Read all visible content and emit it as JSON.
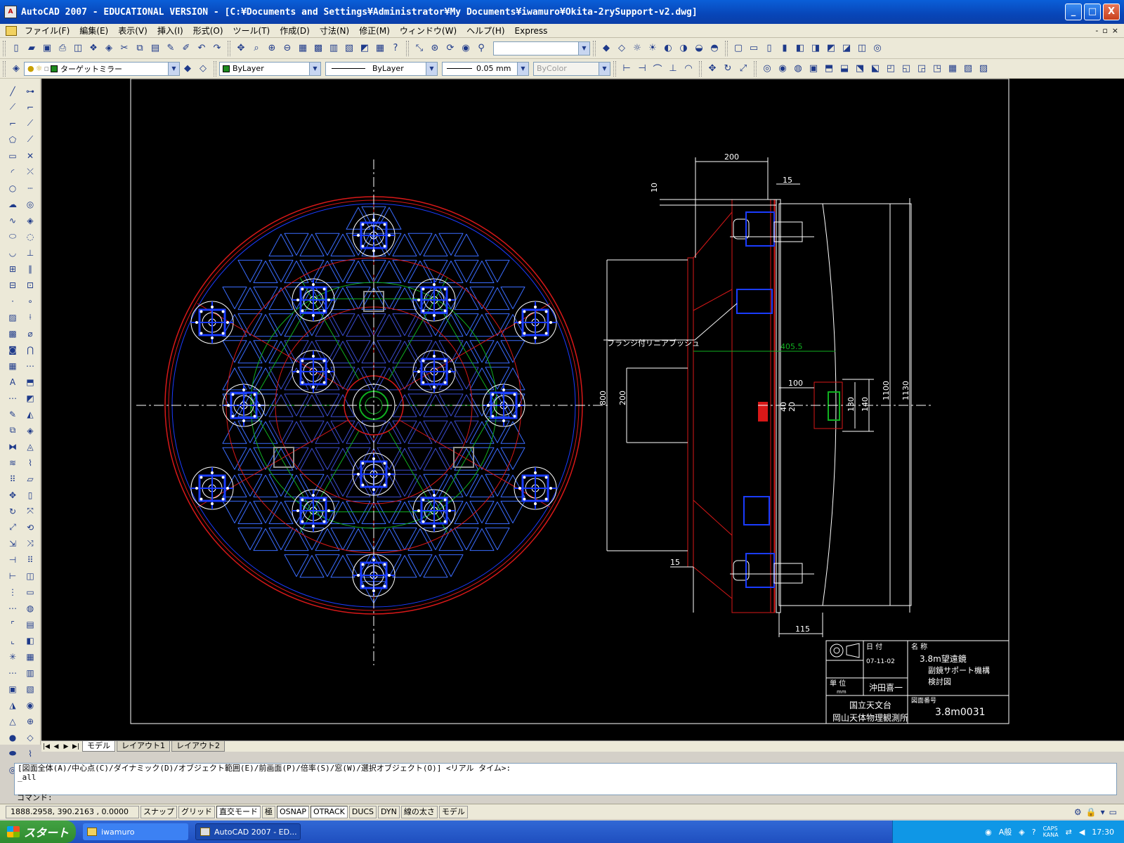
{
  "window": {
    "title": "AutoCAD 2007 - EDUCATIONAL VERSION - [C:¥Documents and Settings¥Administrator¥My Documents¥iwamuro¥Okita-2rySupport-v2.dwg]",
    "min_glyph": "_",
    "max_glyph": "□",
    "close_glyph": "X"
  },
  "menu": {
    "items": [
      "ファイル(F)",
      "編集(E)",
      "表示(V)",
      "挿入(I)",
      "形式(O)",
      "ツール(T)",
      "作成(D)",
      "寸法(N)",
      "修正(M)",
      "ウィンドウ(W)",
      "ヘルプ(H)",
      "Express"
    ],
    "mdi": [
      "-",
      "▫",
      "×"
    ]
  },
  "properties_bar": {
    "layer": "ターゲットミラー",
    "color": "ByLayer",
    "linetype": "ByLayer",
    "lineweight": "0.05 mm",
    "plotstyle": "ByColor"
  },
  "drawing": {
    "dims": {
      "d200_top": "200",
      "d10": "10",
      "d15_top": "15",
      "d405": "405.5",
      "d100": "100",
      "d800": "800",
      "d200_left": "200",
      "d130": "130",
      "d140": "140",
      "d1100": "1100",
      "d1130": "1130",
      "d15_bot": "15",
      "d115": "115",
      "d40": "40",
      "d20": "20"
    },
    "annotation": "フランジ付リニアブッシュ",
    "title_block": {
      "date_label": "日 付",
      "date": "07-11-02",
      "name_label": "名 称",
      "name_line1": "3.8m望遠鏡",
      "name_line2": "副鏡サポート機構",
      "name_line3": "検討図",
      "unit_label": "単 位",
      "unit": "mm",
      "author": "沖田喜一",
      "org1": "国立天文台",
      "org2": "岡山天体物理観測所",
      "drawing_no_label": "図面番号",
      "drawing_no": "3.8m0031"
    },
    "colors": {
      "red": "#d81818",
      "blue": "#1a3cff",
      "lightblue": "#3a6cff",
      "green": "#10b020",
      "white": "#ffffff",
      "grey": "#909090"
    }
  },
  "layout_tabs": [
    "モデル",
    "レイアウト1",
    "レイアウト2"
  ],
  "command": {
    "line1": "[図面全体(A)/中心点(C)/ダイナミック(D)/オブジェクト範囲(E)/前画面(P)/倍率(S)/窓(W)/選択オブジェクト(O)] <リアル タイム>:",
    "line2": "_all",
    "prompt": "コマンド:"
  },
  "status": {
    "coords": "1888.2958, 390.2163 , 0.0000",
    "buttons": [
      "スナップ",
      "グリッド",
      "直交モード",
      "極",
      "OSNAP",
      "OTRACK",
      "DUCS",
      "DYN",
      "線の太さ",
      "モデル"
    ]
  },
  "taskbar": {
    "start": "スタート",
    "tasks": [
      "iwamuro",
      "AutoCAD 2007 - ED..."
    ],
    "ime": "A般",
    "caps": "CAPS",
    "kana": "KANA",
    "clock": "17:30"
  }
}
